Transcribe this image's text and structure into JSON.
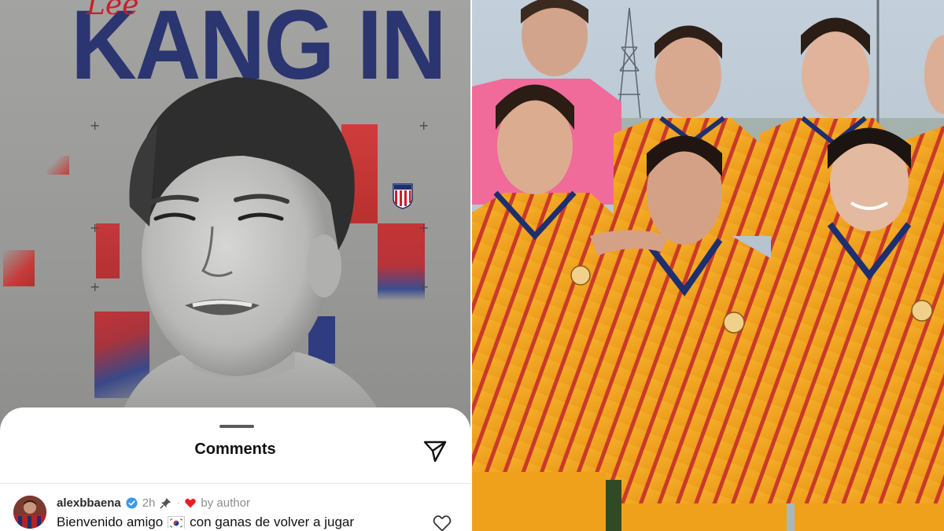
{
  "poster": {
    "script_text": "Lee",
    "title": "KANG IN"
  },
  "comments_sheet": {
    "title": "Comments"
  },
  "comment": {
    "username": "alexbbaena",
    "time": "2h",
    "liked_by_author": "by author",
    "text_before_flag": "Bienvenido amigo",
    "text_after_flag": "con ganas de volver a jugar"
  },
  "colors": {
    "poster_navy": "#2b3570",
    "poster_red": "#c63c3a",
    "kit_yellow": "#f2a31c",
    "kit_red": "#c3262a",
    "goalkeeper_pink": "#f06a9a",
    "verified_blue": "#3897f0",
    "heart_red": "#ed1c24"
  },
  "icons": {
    "share": "paper-plane-icon",
    "like": "heart-outline-icon",
    "verified": "verified-badge-icon",
    "pin": "pin-icon",
    "liked": "heart-filled-icon",
    "flag": "south-korea-flag-icon",
    "crest": "atletico-madrid-crest-icon"
  }
}
